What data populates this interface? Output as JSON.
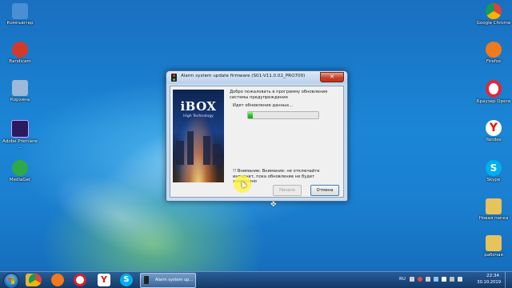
{
  "window": {
    "title": "Alarm system update firmware (S01-V11.0.02_PRO700)",
    "close_label": "✕",
    "banner": {
      "logo": "iBOX",
      "tagline": "High Technology"
    },
    "welcome_text": "Добро пожаловать в программу обновления системы предупреждения",
    "status_text": "Идет обновление данных...",
    "progress_fraction": 0.07,
    "warning_text": "!! Внимание: Внимание: не отключайте интернет, пока обновление не будет завершено",
    "next_label": "Начало",
    "cancel_label": "Отмена"
  },
  "desktop_left": [
    {
      "label": "Компьютер",
      "color": "#4a8fd4"
    },
    {
      "label": "Bandicam",
      "color": "#d23a2a"
    },
    {
      "label": "Корзина",
      "color": "#9db8d8"
    },
    {
      "label": "Adobe Premiere ...",
      "color": "#2a1b5e"
    },
    {
      "label": "MediaGet",
      "color": "#2fa84a"
    }
  ],
  "desktop_right": [
    {
      "label": "Google Chrome",
      "color": "#e9e9e9"
    },
    {
      "label": "Firefox",
      "color": "#f07a1c"
    },
    {
      "label": "Браузер Opera",
      "color": "#e32636"
    },
    {
      "label": "Yandex",
      "color": "#ffffff"
    },
    {
      "label": "Skype",
      "color": "#00aff0"
    },
    {
      "label": "Новая папка",
      "color": "#e8c25a"
    },
    {
      "label": "рабочая",
      "color": "#e8c25a"
    }
  ],
  "taskbar": {
    "apps": [
      {
        "name": "windows-explorer",
        "color": "#e7b53b"
      },
      {
        "name": "chrome",
        "color": "#dcdcdc"
      },
      {
        "name": "firefox",
        "color": "#f07a1c"
      },
      {
        "name": "opera",
        "color": "#d8222f"
      },
      {
        "name": "yandex",
        "color": "#ffffff"
      },
      {
        "name": "skype",
        "color": "#00aff0"
      }
    ],
    "task_label": "Alarm system up...",
    "language": "RU",
    "time": "22:34",
    "date": "30.10.2019"
  }
}
